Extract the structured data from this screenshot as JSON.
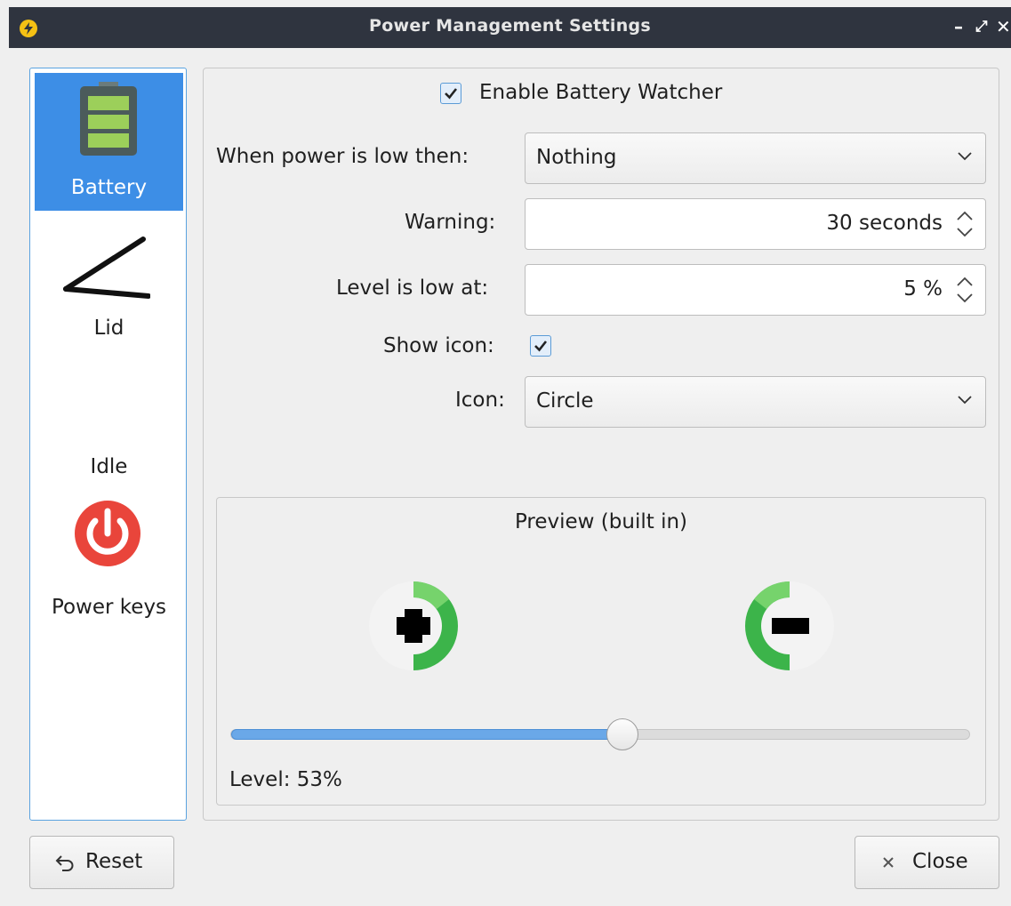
{
  "window": {
    "title": "Power Management Settings",
    "controls": {
      "minimize": "–",
      "maximize": "⤢",
      "close": "✕"
    }
  },
  "sidebar": {
    "items": [
      {
        "label": "Battery",
        "icon": "battery-icon",
        "active": true
      },
      {
        "label": "Lid",
        "icon": "lid-icon",
        "active": false
      },
      {
        "label": "Idle",
        "icon": "idle-icon",
        "active": false
      },
      {
        "label": "Power keys",
        "icon": "power-icon",
        "active": false
      }
    ]
  },
  "battery": {
    "enable_watcher": {
      "label": "Enable Battery Watcher",
      "checked": true
    },
    "low_action": {
      "label": "When power is low then:",
      "value": "Nothing"
    },
    "warning": {
      "label": "Warning:",
      "value": "30 seconds"
    },
    "low_level": {
      "label": "Level is low at:",
      "value": "5 %"
    },
    "show_icon": {
      "label": "Show icon:",
      "checked": true
    },
    "icon": {
      "label": "Icon:",
      "value": "Circle"
    },
    "preview": {
      "title": "Preview (built in)",
      "level_text": "Level: 53%",
      "level": 53,
      "charging_icon": "battery-charging-circle-icon",
      "discharging_icon": "battery-discharging-circle-icon"
    }
  },
  "footer": {
    "reset_label": "Reset",
    "close_label": "Close"
  },
  "colors": {
    "accent": "#3d8ee6",
    "titlebar": "#2f343f",
    "battery_green": "#3cb44a",
    "power_red": "#e9453b"
  }
}
